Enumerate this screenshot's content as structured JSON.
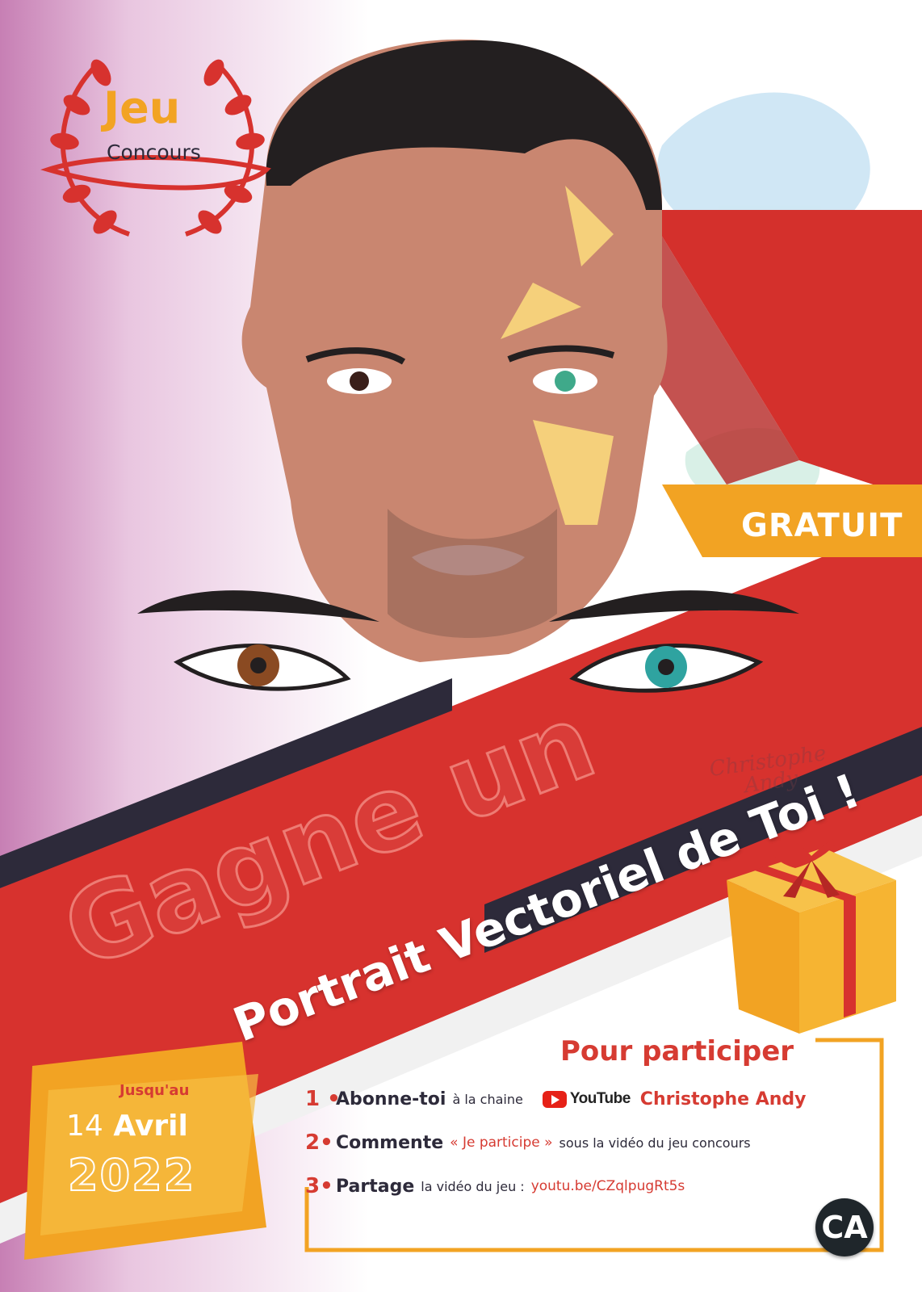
{
  "badge": {
    "line1": "Jeu",
    "line2": "Concours"
  },
  "tag": "GRATUIT",
  "headline": {
    "line1": "Gagne un",
    "line2": "Portrait Vectoriel de Toi !"
  },
  "watermark": {
    "line1": "Christophe",
    "line2": "Andy"
  },
  "participate": {
    "title": "Pour participer",
    "steps": [
      {
        "number": "1 •",
        "action": "Abonne-toi",
        "detail": "à la chaine",
        "platform": "YouTube",
        "channel": "Christophe Andy"
      },
      {
        "number": "2•",
        "action": "Commente",
        "quote": "« Je participe »",
        "detail": "sous la vidéo du jeu concours"
      },
      {
        "number": "3•",
        "action": "Partage",
        "detail": "la vidéo du jeu :",
        "link": "youtu.be/CZqlpugRt5s"
      }
    ]
  },
  "deadline": {
    "prefix": "Jusqu'au",
    "day": "14",
    "month": "Avril",
    "year": "2022"
  },
  "logo": "CA",
  "icons": [
    "laurel-wreath-icon",
    "gift-box-icon",
    "youtube-logo-icon"
  ],
  "colors": {
    "red": "#d63b32",
    "orange": "#f2a323",
    "dark": "#2d2a3a",
    "purple": "#c77fb4"
  }
}
